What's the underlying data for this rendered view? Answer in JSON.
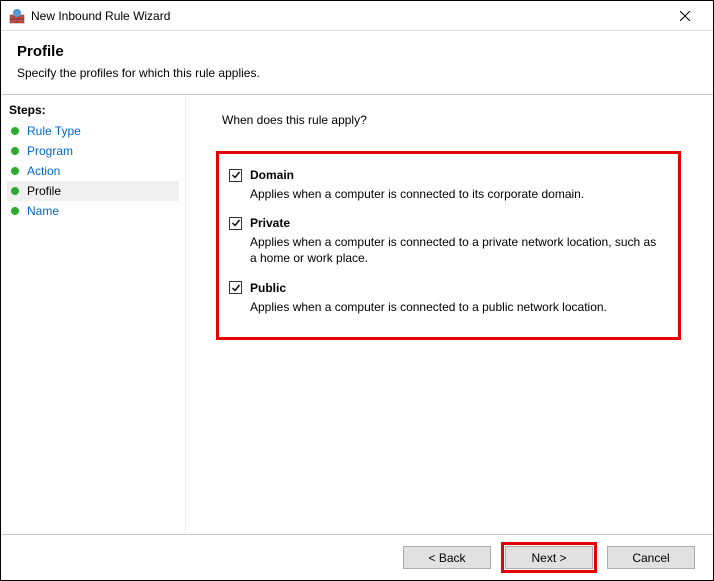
{
  "window": {
    "title": "New Inbound Rule Wizard"
  },
  "header": {
    "title": "Profile",
    "subtitle": "Specify the profiles for which this rule applies."
  },
  "sidebar": {
    "title": "Steps:",
    "items": [
      {
        "label": "Rule Type",
        "current": false
      },
      {
        "label": "Program",
        "current": false
      },
      {
        "label": "Action",
        "current": false
      },
      {
        "label": "Profile",
        "current": true
      },
      {
        "label": "Name",
        "current": false
      }
    ]
  },
  "main": {
    "prompt": "When does this rule apply?",
    "checks": [
      {
        "label": "Domain",
        "desc": "Applies when a computer is connected to its corporate domain."
      },
      {
        "label": "Private",
        "desc": "Applies when a computer is connected to a private network location, such as a home or work place."
      },
      {
        "label": "Public",
        "desc": "Applies when a computer is connected to a public network location."
      }
    ]
  },
  "footer": {
    "back": "< Back",
    "next": "Next >",
    "cancel": "Cancel"
  }
}
